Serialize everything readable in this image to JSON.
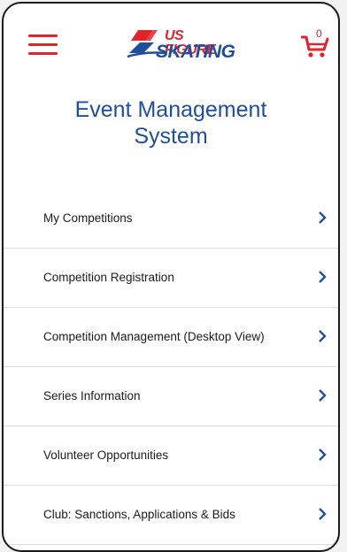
{
  "header": {
    "logo_line1": "US FIGURE",
    "logo_line2": "SKATING",
    "cart_count": "0",
    "brand_red": "#e0242b",
    "brand_blue": "#1f4f9b"
  },
  "page": {
    "title_line1": "Event Management",
    "title_line2": "System"
  },
  "menu": {
    "items": [
      {
        "label": "My Competitions",
        "icon": "chevron-right-icon"
      },
      {
        "label": "Competition Registration",
        "icon": "chevron-right-icon"
      },
      {
        "label": "Competition Management (Desktop View)",
        "icon": "chevron-right-icon"
      },
      {
        "label": "Series Information",
        "icon": "chevron-right-icon"
      },
      {
        "label": "Volunteer Opportunities",
        "icon": "chevron-right-icon"
      },
      {
        "label": "Club: Sanctions, Applications & Bids",
        "icon": "chevron-right-icon"
      }
    ]
  }
}
